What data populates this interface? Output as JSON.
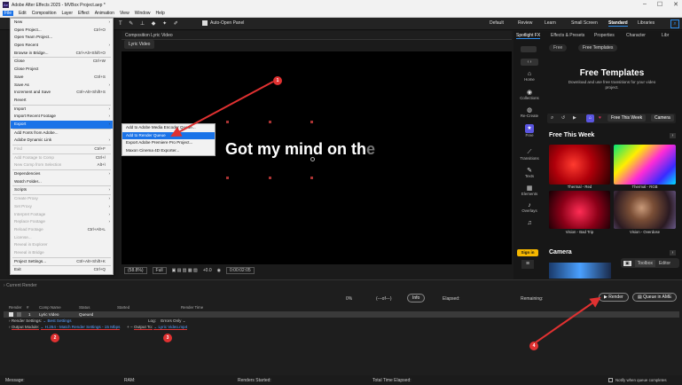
{
  "titlebar": {
    "logo": "Ae",
    "title": "Adobe After Effects 2025 - MVBox Project.aep *"
  },
  "menubar": [
    "File",
    "Edit",
    "Composition",
    "Layer",
    "Effect",
    "Animation",
    "View",
    "Window",
    "Help"
  ],
  "toolbar": {
    "open_panel": "Auto-Open Panel",
    "workspaces": [
      "Default",
      "Review",
      "Learn",
      "Small Screen",
      "Standard",
      "Libraries"
    ],
    "active_workspace": "Standard"
  },
  "file_menu": [
    {
      "label": "New",
      "arrow": true
    },
    {
      "label": "Open Project...",
      "shortcut": "Ctrl+O"
    },
    {
      "label": "Open Team Project..."
    },
    {
      "label": "Open Recent",
      "arrow": true
    },
    {
      "label": "Browse in Bridge...",
      "shortcut": "Ctrl+Alt+Shift+O"
    },
    {
      "sep": true
    },
    {
      "label": "Close",
      "shortcut": "Ctrl+W"
    },
    {
      "label": "Close Project"
    },
    {
      "label": "Save",
      "shortcut": "Ctrl+S"
    },
    {
      "label": "Save As",
      "arrow": true
    },
    {
      "label": "Increment and Save",
      "shortcut": "Ctrl+Alt+Shift+S"
    },
    {
      "label": "Revert"
    },
    {
      "sep": true
    },
    {
      "label": "Import",
      "arrow": true
    },
    {
      "label": "Import Recent Footage",
      "arrow": true
    },
    {
      "label": "Export",
      "arrow": true,
      "highlight": true
    },
    {
      "sep": true
    },
    {
      "label": "Add Fonts from Adobe..."
    },
    {
      "label": "Adobe Dynamic Link",
      "arrow": true
    },
    {
      "sep": true
    },
    {
      "label": "Find",
      "shortcut": "Ctrl+F",
      "disabled": true
    },
    {
      "sep": true
    },
    {
      "label": "Add Footage to Comp",
      "shortcut": "Ctrl+/",
      "disabled": true
    },
    {
      "label": "New Comp from Selection",
      "shortcut": "Alt+\\",
      "disabled": true
    },
    {
      "sep": true
    },
    {
      "label": "Dependencies",
      "arrow": true
    },
    {
      "label": "Watch Folder..."
    },
    {
      "sep": true
    },
    {
      "label": "Scripts",
      "arrow": true
    },
    {
      "sep": true
    },
    {
      "label": "Create Proxy",
      "arrow": true,
      "disabled": true
    },
    {
      "label": "Set Proxy",
      "arrow": true,
      "disabled": true
    },
    {
      "label": "Interpret Footage",
      "arrow": true,
      "disabled": true
    },
    {
      "label": "Replace Footage",
      "arrow": true,
      "disabled": true
    },
    {
      "label": "Reload Footage",
      "shortcut": "Ctrl+Alt+L",
      "disabled": true
    },
    {
      "label": "License...",
      "disabled": true
    },
    {
      "label": "Reveal in Explorer",
      "disabled": true
    },
    {
      "label": "Reveal in Bridge",
      "disabled": true
    },
    {
      "sep": true
    },
    {
      "label": "Project Settings...",
      "shortcut": "Ctrl+Alt+Shift+K"
    },
    {
      "sep": true
    },
    {
      "label": "Exit",
      "shortcut": "Ctrl+Q"
    }
  ],
  "export_submenu": [
    {
      "label": "Add to Adobe Media Encoder Queue..."
    },
    {
      "label": "Add to Render Queue",
      "highlight": true
    },
    {
      "label": "Export Adobe Premiere Pro Project..."
    },
    {
      "label": "Maxon Cinema 4D Exporter..."
    }
  ],
  "composition": {
    "header": "Composition Lyric Video",
    "tab": "Lyric Video",
    "lyric_main": "Got my mind on th",
    "lyric_fade": "e"
  },
  "viewer_footer": {
    "zoom": "(58.8%)",
    "quality": "Full",
    "plus": "+0.0",
    "timecode": "0:00:02:05"
  },
  "right_panel": {
    "tabs": [
      "Spotlight FX",
      "Effects & Presets",
      "Properties",
      "Character",
      "Libr"
    ],
    "nav": [
      {
        "icon": "⌂",
        "label": "Home"
      },
      {
        "icon": "◉",
        "label": "Collections"
      },
      {
        "icon": "◍",
        "label": "Re-Create"
      },
      {
        "icon": "★",
        "label": "Free",
        "active": true
      },
      {
        "icon": "⟋",
        "label": "Transitions"
      },
      {
        "icon": "✎",
        "label": "Texts"
      },
      {
        "icon": "▦",
        "label": "Elements"
      },
      {
        "icon": "♪",
        "label": "Overlays"
      },
      {
        "icon": "♫",
        "label": ""
      },
      {
        "icon": "",
        "label": "Studio"
      }
    ],
    "top_pills": [
      "Free",
      "Free Templates"
    ],
    "promo_title": "Free Templates",
    "promo_sub": "Download and use free transitions for your video project.",
    "filter_chips": [
      "Free This Week",
      "Camera"
    ],
    "free_this_week": "Free This Week",
    "thumbs": [
      "Thermal - Red",
      "Thermal - RGB",
      "Vision - Bad Trip",
      "Vision - Overdose"
    ],
    "camera": "Camera",
    "sign_in": "Sign in",
    "toolbox": "Toolbox",
    "editor": "Editor",
    "colors": {
      "accent": "#5a55e0",
      "sign_in": "#f5b700"
    }
  },
  "render_queue": {
    "current_render": "Current Render",
    "progress_pct": "0%",
    "progress_mid": "(---of---)",
    "info": "Info",
    "elapsed": "Elapsed:",
    "remaining": "Remaining:",
    "render_btn": "Render",
    "queue_btn": "Queue in AME",
    "columns": [
      "Render",
      "#",
      "Comp Name",
      "Status",
      "Started",
      "Render Time"
    ],
    "row": {
      "num": "1",
      "comp": "Lyric Video",
      "status": "Queued"
    },
    "render_settings_label": "Render Settings:",
    "render_settings_value": "Best Settings",
    "log_label": "Log:",
    "log_value": "Errors Only",
    "output_module_label": "Output Module:",
    "output_module_value": "H.264 - Match Render Settings - 15 Mbps",
    "output_to_label": "Output To:",
    "output_to_value": "Lyric Video.mp4",
    "footer": [
      "Message:",
      "RAM:",
      "Renders Started:",
      "Total Time Elapsed:"
    ],
    "notify": "Notify when queue completes"
  },
  "annotations": [
    "1",
    "2",
    "3",
    "4"
  ],
  "colors": {
    "annotation": "#e03131",
    "highlight": "#1a73e8"
  }
}
